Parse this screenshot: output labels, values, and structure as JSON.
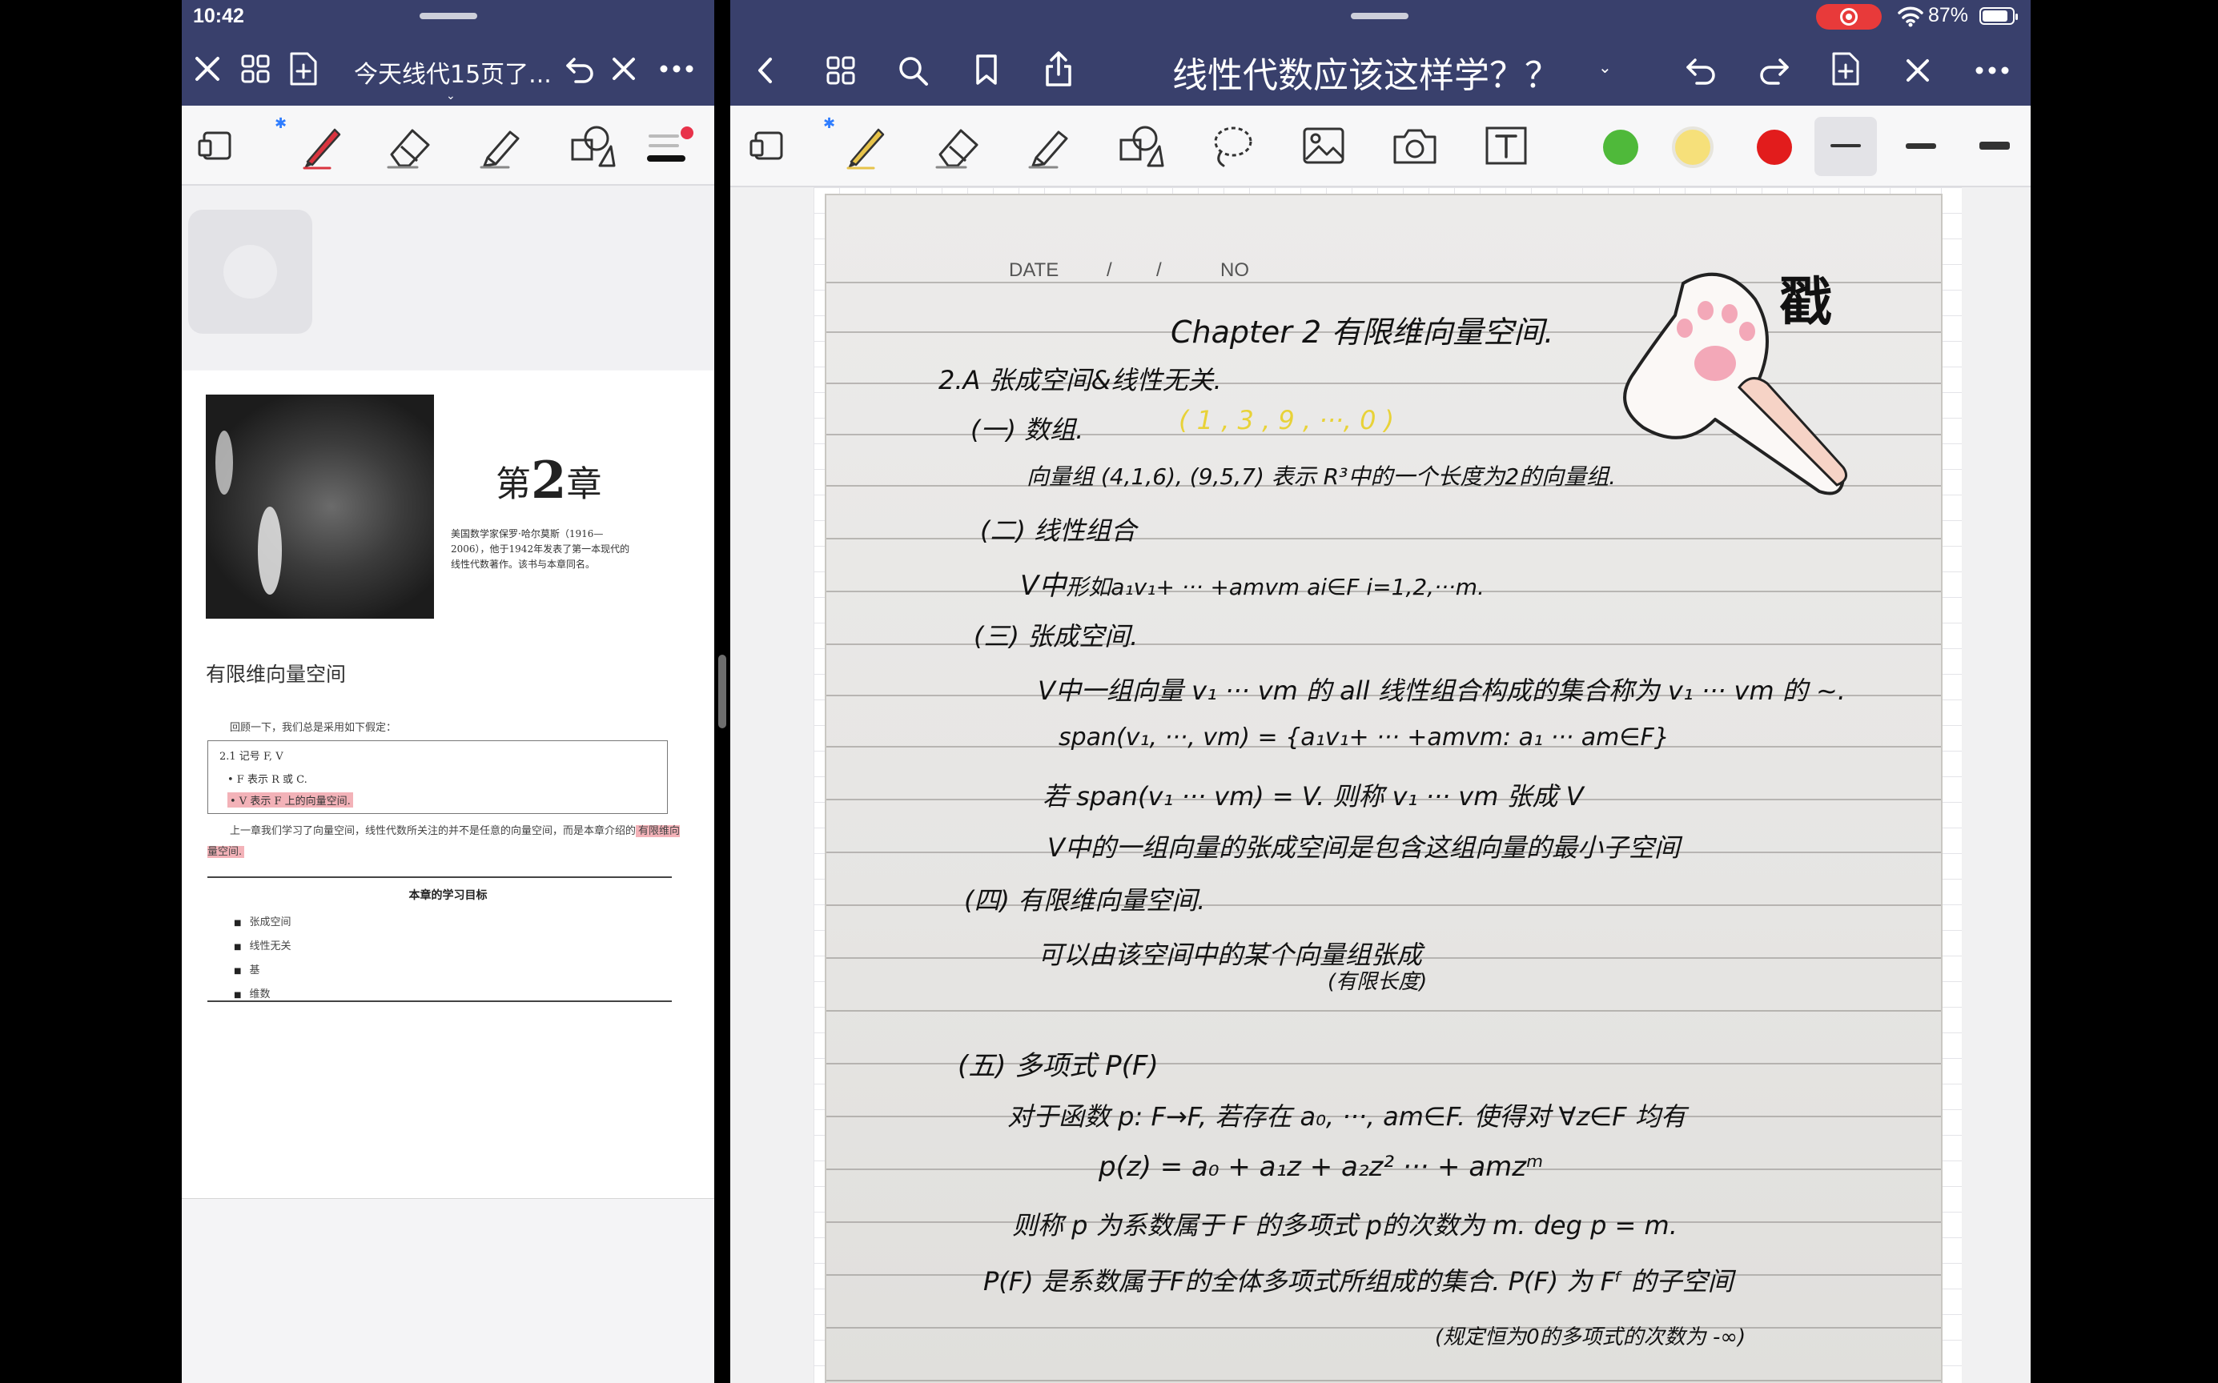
{
  "status_bar": {
    "time": "10:42",
    "battery_percent": "87%",
    "battery_level": 0.87
  },
  "left_app": {
    "title": "今天线代15页了...",
    "toolbar": {
      "tools": [
        "view-mode-icon",
        "bluetooth-icon",
        "pen-icon",
        "eraser-icon",
        "highlighter-icon",
        "shapes-icon",
        "pen-settings-icon"
      ]
    }
  },
  "pdf": {
    "chapter_prefix": "第",
    "chapter_num": "2",
    "chapter_suffix": "章",
    "caption": "美国数学家保罗·哈尔莫斯（1916—2006），他于1942年发表了第一本现代的线性代数著作。该书与本章同名。",
    "section_title": "有限维向量空间",
    "intro": "回顾一下，我们总是采用如下假定：",
    "box": {
      "line1": "2.1  记号  F, V",
      "line2": "• F 表示 R 或 C.",
      "line3": "• V 表示 F 上的向量空间."
    },
    "paragraph_a": "上一章我们学习了向量空间，线性代数所关注的并不是任意的向量空间，而是本章介绍的",
    "paragraph_b": "有限维向量空间.",
    "goals_title": "本章的学习目标",
    "goals": [
      "张成空间",
      "线性无关",
      "基",
      "维数"
    ]
  },
  "right_app": {
    "title": "线性代数应该这样学？？",
    "colors": {
      "green": "#4fb93a",
      "yellow": "#f6e07a",
      "red": "#e21c1c",
      "bar": "#39406c"
    }
  },
  "notes": {
    "date_label": "DATE",
    "date_slash1": "/",
    "date_slash2": "/",
    "no_label": "NO",
    "line_chapter": "Chapter  2    有限维向量空间.",
    "line_2a": "2.A   张成空间&线性无关.",
    "line_1": "(一) 数组.",
    "line_1_yellow": "( 1 , 3 , 9 , ···, 0 )",
    "line_1b": "向量组    (4,1,6), (9,5,7)   表示 R³中的一个长度为2的向量组.",
    "line_2": "(二) 线性组合",
    "line_2b": "V中",
    "line_2b_yellow": "形如",
    "line_2b_rest": "a₁v₁+ ··· +amvm         ai∈F    i=1,2,···m.",
    "line_3": "(三) 张成空间.",
    "line_3b": "V中一组向量 v₁ ··· vm 的 all 线性组合构成的集合称为 v₁ ··· vm 的 ~.",
    "line_3c": "span(v₁, ···, vm) = {a₁v₁+ ··· +amvm: a₁ ··· am∈F}",
    "line_3d": "若 span(v₁ ··· vm) = V. 则称 v₁ ··· vm 张成 V",
    "line_3e": "V中的一组向量的张成空间是包含这组向量的最小子空间",
    "line_4": "(四) 有限维向量空间.",
    "line_4b": "可以由该空间中的某个向量组张成",
    "line_4c": "(有限长度)",
    "line_5": "(五) 多项式   P(F)",
    "line_5b": "对于函数 p: F→F, 若存在 a₀, ···, am∈F. 使得对 ∀z∈F 均有",
    "line_5c": "p(z) = a₀ + a₁z + a₂z² ··· + amzᵐ",
    "line_5d": "则称 p 为系数属于 F 的多项式          p的次数为 m.  deg p = m.",
    "line_5e": "P(F) 是系数属于F的全体多项式所组成的集合.        P(F) 为 Fᶠ 的子空间",
    "line_5f": "(规定恒为0的多项式的次数为 -∞)",
    "sticker_text": "戳"
  }
}
